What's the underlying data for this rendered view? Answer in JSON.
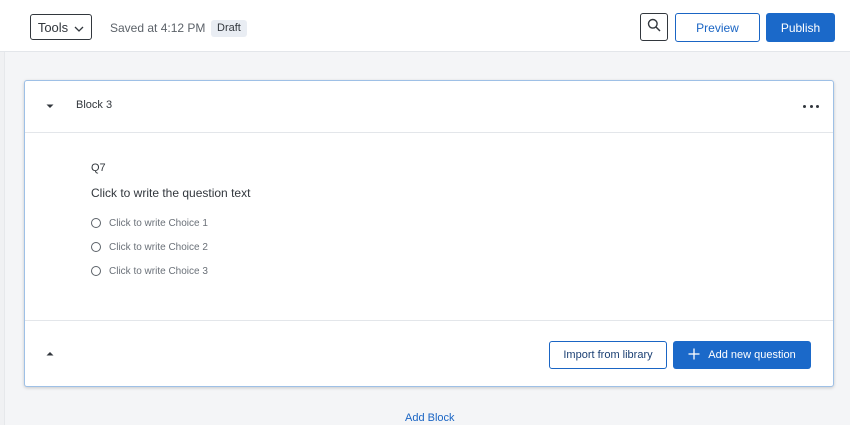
{
  "toolbar": {
    "tools_label": "Tools",
    "saved_text": "Saved at 4:12 PM",
    "draft_badge": "Draft",
    "preview_label": "Preview",
    "publish_label": "Publish"
  },
  "block": {
    "title": "Block 3",
    "question": {
      "number": "Q7",
      "text": "Click to write the question text",
      "choices": [
        {
          "label": "Click to write Choice 1"
        },
        {
          "label": "Click to write Choice 2"
        },
        {
          "label": "Click to write Choice 3"
        }
      ]
    },
    "footer": {
      "import_label": "Import from library",
      "add_question_label": "Add new question"
    }
  },
  "add_block_label": "Add Block",
  "colors": {
    "accent": "#1b69c9",
    "text": "#32373d",
    "canvas_bg": "#f4f5f7"
  },
  "icons": {
    "tools_chevron": "chevron-down-icon",
    "search": "search-icon",
    "block_collapse": "caret-down-icon",
    "more": "more-horizontal-icon",
    "footer_collapse": "caret-up-icon",
    "add": "plus-icon"
  }
}
